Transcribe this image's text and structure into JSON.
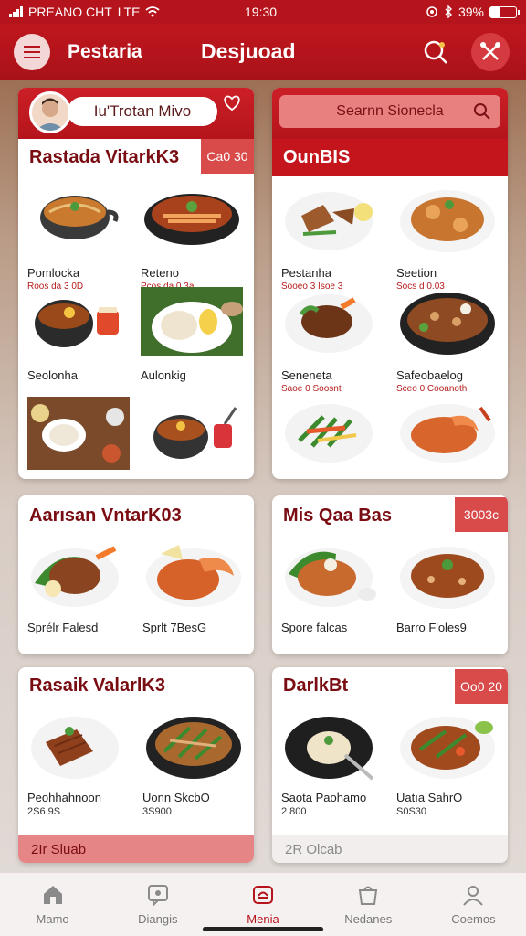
{
  "status": {
    "carrier": "PREANO CHT",
    "network": "LTE",
    "time": "19:30",
    "battery": "39%",
    "battery_level": 0.39
  },
  "header": {
    "brand": "Pestaria",
    "title": "Desjuoad"
  },
  "panels": {
    "p1": {
      "pill_text": "Iu'Trotan Mivo",
      "title": "Rastada VitarkK3",
      "badge": "Ca0 30",
      "items": [
        {
          "name": "Pomlocka",
          "sub": "Roos da 3 0D",
          "icon": "noodle-bowl-icon"
        },
        {
          "name": "Reteno",
          "sub": "Pcos da 0.3a",
          "icon": "hotpot-icon"
        },
        {
          "name": "Seolonha",
          "sub": "",
          "icon": "curry-bowl-icon"
        },
        {
          "name": "Aulonkig",
          "sub": "",
          "icon": "rice-egg-plate-icon"
        },
        {
          "name": "",
          "sub": "",
          "icon": "table-spread-icon"
        },
        {
          "name": "",
          "sub": "",
          "icon": "soup-drink-icon"
        }
      ]
    },
    "p2": {
      "search_placeholder": "Searnn Sionecla",
      "title": "OunBIS",
      "items": [
        {
          "name": "Pestanha",
          "sub": "Sooeo 3 Isoe 3",
          "icon": "chicken-plate-icon"
        },
        {
          "name": "Seetion",
          "sub": "Socs d 0.03",
          "icon": "shrimp-plate-icon"
        },
        {
          "name": "Seneneta",
          "sub": "Saoe 0 Soosnt",
          "icon": "beef-plate-icon"
        },
        {
          "name": "Safeobaelog",
          "sub": "Sceo 0 Cooanoth",
          "icon": "stirfry-bowl-icon"
        },
        {
          "name": "",
          "sub": "",
          "icon": "veg-salad-icon"
        },
        {
          "name": "",
          "sub": "",
          "icon": "shrimp-pasta-icon"
        }
      ]
    },
    "p3": {
      "title": "Aarısan VntarK03",
      "items": [
        {
          "name": "Sprélr Falesd",
          "icon": "roast-plate-icon"
        },
        {
          "name": "Sprlt 7BesG",
          "icon": "lobster-pasta-icon"
        }
      ]
    },
    "p4": {
      "title": "Mis Qaa Bas",
      "badge": "3003c",
      "items": [
        {
          "name": "Spore falcas",
          "icon": "rice-dish-icon"
        },
        {
          "name": "Barro F'oles9",
          "icon": "soup-bowl-icon"
        }
      ]
    },
    "p5": {
      "title": "Rasaik ValarlK3",
      "strip": "2Ir Sluab",
      "items": [
        {
          "name": "Peohhahnoon",
          "price": "2S6 9S",
          "icon": "ribs-plate-icon"
        },
        {
          "name": "Uonn SkcbO",
          "price": "3S900",
          "icon": "noodle-stirfry-icon"
        }
      ]
    },
    "p6": {
      "title": "DarlkBt",
      "badge": "Oo0 20",
      "strip": "2R Olcab",
      "items": [
        {
          "name": "Saota Paohamo",
          "price": "2 800",
          "icon": "dumpling-plate-icon"
        },
        {
          "name": "Uatıa SahrO",
          "price": "S0S30",
          "icon": "veg-stirfry-icon"
        }
      ]
    }
  },
  "tabs": [
    {
      "label": "Mamo",
      "icon": "home-icon",
      "active": false
    },
    {
      "label": "Diangis",
      "icon": "chat-icon",
      "active": false
    },
    {
      "label": "Menia",
      "icon": "menu-card-icon",
      "active": true
    },
    {
      "label": "Nedanes",
      "icon": "bag-icon",
      "active": false
    },
    {
      "label": "Coemos",
      "icon": "user-icon",
      "active": false
    }
  ],
  "colors": {
    "primary": "#b5141c",
    "badge": "#d94a4a",
    "strip": "#e58585"
  }
}
